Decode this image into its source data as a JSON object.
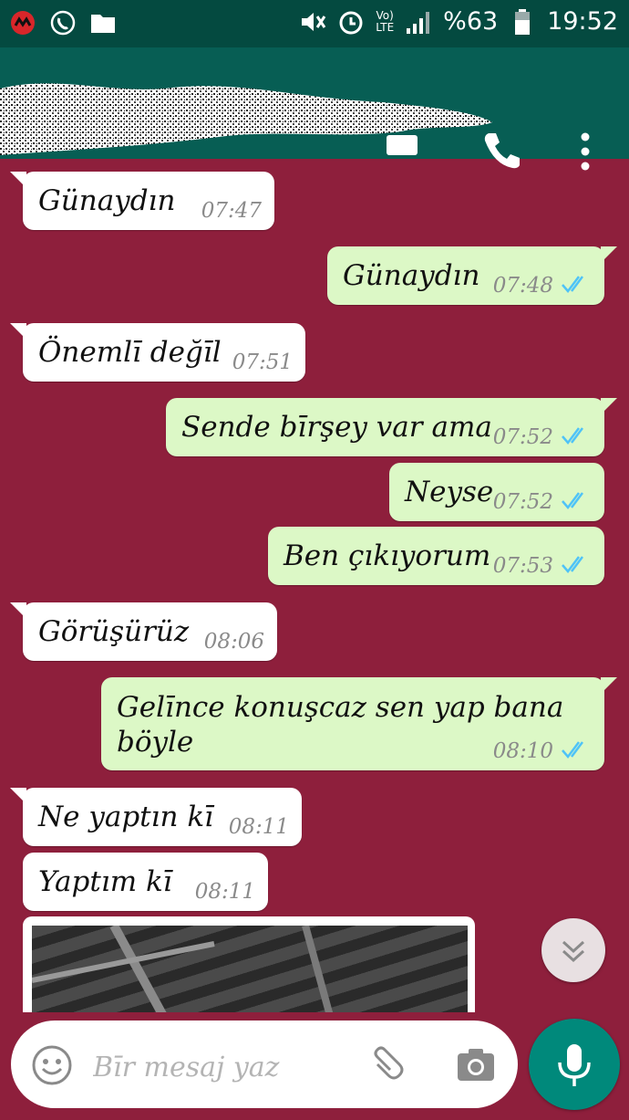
{
  "status_bar": {
    "battery": "%63",
    "time": "19:52",
    "volte": "Vo)",
    "lte": "LTE",
    "icons": [
      "app-notification-icon",
      "whatsapp-notification-icon",
      "folder-icon",
      "mute-icon",
      "alarm-icon",
      "volte-icon",
      "signal-icon",
      "battery-icon"
    ]
  },
  "toolbar": {
    "contact_name_redacted": true,
    "icons": [
      "video-call-icon",
      "phone-icon",
      "more-vert-icon"
    ]
  },
  "messages": [
    {
      "dir": "in",
      "text": "Günaydın",
      "time": "07:47"
    },
    {
      "dir": "out",
      "text": "Günaydın",
      "time": "07:48",
      "read": true
    },
    {
      "dir": "in",
      "text": "Önemlī değīl",
      "time": "07:51"
    },
    {
      "dir": "out",
      "text": "Sende bīrşey var ama",
      "time": "07:52",
      "read": true
    },
    {
      "dir": "out",
      "text": "Neyse",
      "time": "07:52",
      "read": true
    },
    {
      "dir": "out",
      "text": "Ben çıkıyorum",
      "time": "07:53",
      "read": true
    },
    {
      "dir": "in",
      "text": "Görüşürüz",
      "time": "08:06"
    },
    {
      "dir": "out",
      "text": "Gelīnce konuşcaz sen yap bana böyle",
      "time": "08:10",
      "read": true
    },
    {
      "dir": "in",
      "text": "Ne yaptın kī",
      "time": "08:11"
    },
    {
      "dir": "in",
      "text": "Yaptım kī",
      "time": "08:11"
    }
  ],
  "input": {
    "placeholder": "Bīr mesaj yaz",
    "value": ""
  },
  "colors": {
    "wallpaper": "#8e1f3c",
    "header": "#075e54",
    "status_bar": "#044a40",
    "outgoing_bubble": "#dcf8c6",
    "incoming_bubble": "#ffffff",
    "read_ticks": "#4fc3f7",
    "mic_button": "#00897b"
  }
}
